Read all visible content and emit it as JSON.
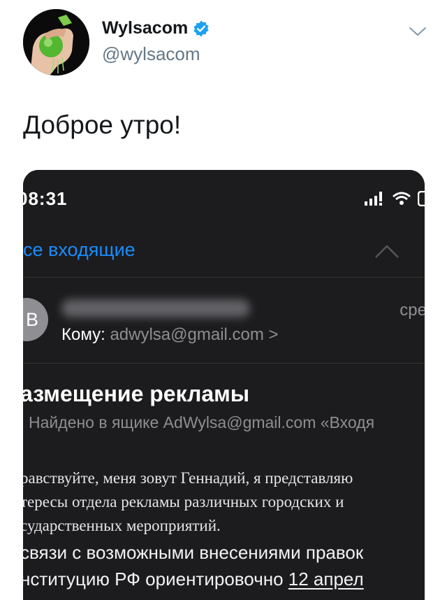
{
  "tweet": {
    "display_name": "Wylsacom",
    "handle": "@wylsacom",
    "text": "Доброе утро!"
  },
  "screenshot": {
    "time": "08:31",
    "back_label": "се входящие",
    "sender_initial": "В",
    "received_time": "сре",
    "to_label": "Кому:",
    "to_address": "adwylsa@gmail.com >",
    "subject": "азмещение рекламы",
    "found_in": "Найдено в ящике AdWylsa@gmail.com «Входя",
    "body_serif_lines": [
      "равствуйте, меня зовут Геннадий, я представляю",
      "тересы отдела рекламы различных городских и",
      "сударственных мероприятий."
    ],
    "body_sans_line1": "связи с возможными внесениями правок",
    "body_sans_line2_prefix": "нституцию РФ ориентировочно ",
    "body_sans_line2_link": "12 апрел"
  },
  "colors": {
    "accent_blue": "#1a8cff",
    "verified_blue": "#1da1f2",
    "dark_bg": "#1c1c1e"
  },
  "icons": [
    "verified-badge-icon",
    "chevron-down-icon",
    "cellular-signal-icon",
    "wifi-icon",
    "battery-icon",
    "chevron-up-icon"
  ]
}
